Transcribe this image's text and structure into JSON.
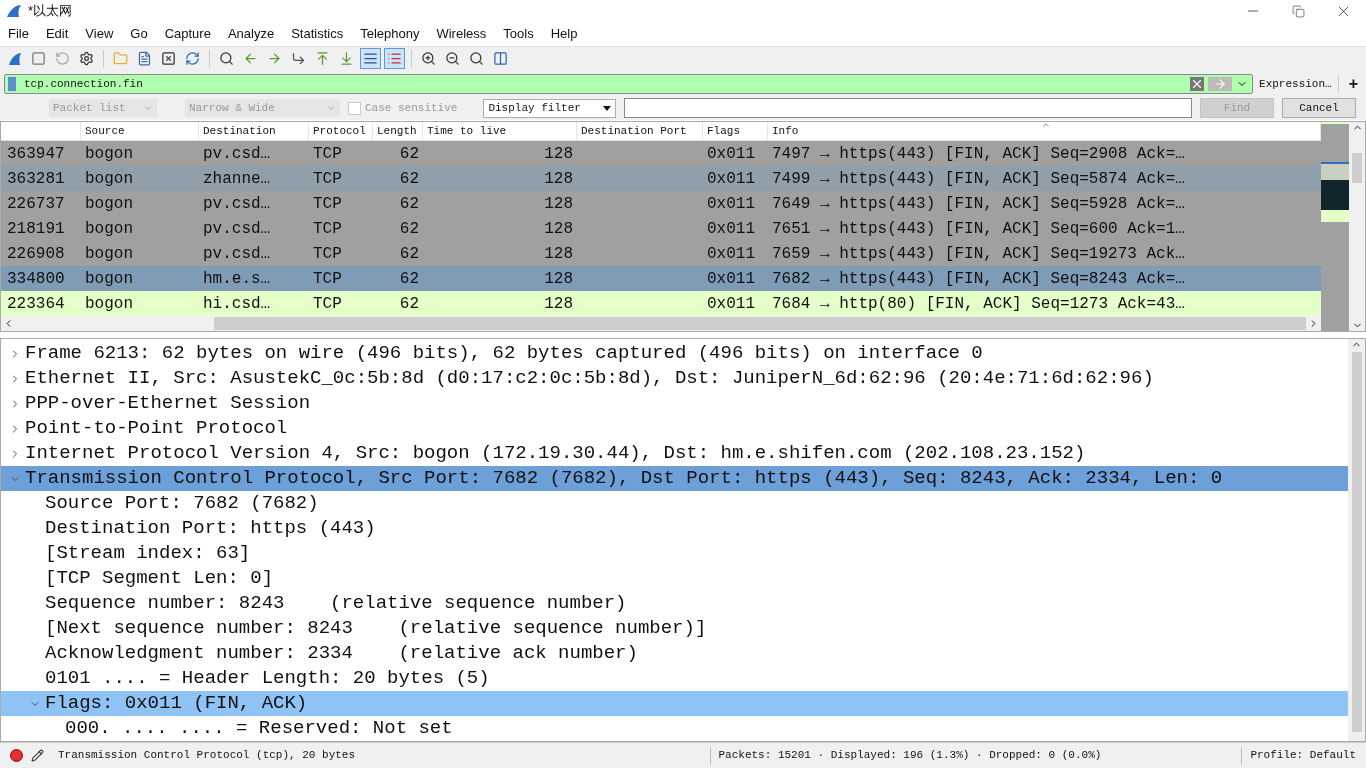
{
  "window": {
    "title": "*以太网"
  },
  "menu": [
    "File",
    "Edit",
    "View",
    "Go",
    "Capture",
    "Analyze",
    "Statistics",
    "Telephony",
    "Wireless",
    "Tools",
    "Help"
  ],
  "toolbar": [
    {
      "pressed": false
    },
    {
      "pressed": false
    },
    {
      "pressed": false
    },
    {
      "pressed": false
    },
    {
      "pressed": false
    },
    {
      "pressed": false
    },
    {
      "pressed": false
    },
    {
      "pressed": false
    },
    {
      "pressed": false
    },
    {
      "pressed": false
    },
    {
      "pressed": false
    },
    {
      "pressed": false
    },
    {
      "pressed": false
    },
    {
      "pressed": false
    },
    {
      "pressed": true
    },
    {
      "pressed": true
    },
    {
      "pressed": false
    },
    {
      "pressed": false
    },
    {
      "pressed": false
    },
    {
      "pressed": false
    }
  ],
  "filter": {
    "value": "tcp.connection.fin",
    "expression": "Expression…",
    "add": "+"
  },
  "find_bar": {
    "search_in": "Packet list",
    "char_width": "Narrow & Wide",
    "case_sensitive": {
      "label": "Case sensitive",
      "checked": false
    },
    "search_type": "Display filter",
    "find": "Find",
    "cancel": "Cancel"
  },
  "packet_list": {
    "columns": [
      "",
      "Source",
      "Destination",
      "Protocol",
      "Length",
      "Time to live",
      "Destination Port",
      "Flags",
      "Info"
    ],
    "rows": [
      {
        "cells": [
          "363947",
          "bogon",
          "pv.csd…",
          "TCP",
          "62",
          "128",
          "",
          "0x011",
          "7497 → https(443) [FIN, ACK] Seq=2908 Ack=…"
        ],
        "color": "#a0a0a0"
      },
      {
        "cells": [
          "363281",
          "bogon",
          "zhanne…",
          "TCP",
          "62",
          "128",
          "",
          "0x011",
          "7499 → https(443) [FIN, ACK] Seq=5874 Ack=…"
        ],
        "color": "#909fa9"
      },
      {
        "cells": [
          "226737",
          "bogon",
          "pv.csd…",
          "TCP",
          "62",
          "128",
          "",
          "0x011",
          "7649 → https(443) [FIN, ACK] Seq=5928 Ack=…"
        ],
        "color": "#a0a0a0"
      },
      {
        "cells": [
          "218191",
          "bogon",
          "pv.csd…",
          "TCP",
          "62",
          "128",
          "",
          "0x011",
          "7651 → https(443) [FIN, ACK] Seq=600 Ack=1…"
        ],
        "color": "#a0a0a0"
      },
      {
        "cells": [
          "226908",
          "bogon",
          "pv.csd…",
          "TCP",
          "62",
          "128",
          "",
          "0x011",
          "7659 → https(443) [FIN, ACK] Seq=19273 Ack…"
        ],
        "color": "#a0a0a0"
      },
      {
        "cells": [
          "334800",
          "bogon",
          "hm.e.s…",
          "TCP",
          "62",
          "128",
          "",
          "0x011",
          "7682 → https(443) [FIN, ACK] Seq=8243 Ack=…"
        ],
        "color": "#7f9bb6"
      },
      {
        "cells": [
          "223364",
          "bogon",
          "hi.csd…",
          "TCP",
          "62",
          "128",
          "",
          "0x011",
          "7684 → http(80) [FIN, ACK] Seq=1273 Ack=43…"
        ],
        "color": "#e4ffc7"
      }
    ]
  },
  "details": [
    {
      "text": "Frame 6213: 62 bytes on wire (496 bits), 62 bytes captured (496 bits) on interface 0",
      "expanded": false,
      "selected": false
    },
    {
      "text": "Ethernet II, Src: AsustekC_0c:5b:8d (d0:17:c2:0c:5b:8d), Dst: JuniperN_6d:62:96 (20:4e:71:6d:62:96)",
      "expanded": false,
      "selected": false
    },
    {
      "text": "PPP-over-Ethernet Session",
      "expanded": false,
      "selected": false
    },
    {
      "text": "Point-to-Point Protocol",
      "expanded": false,
      "selected": false
    },
    {
      "text": "Internet Protocol Version 4, Src: bogon (172.19.30.44), Dst: hm.e.shifen.com (202.108.23.152)",
      "expanded": false,
      "selected": false
    },
    {
      "text": "Transmission Control Protocol, Src Port: 7682 (7682), Dst Port: https (443), Seq: 8243, Ack: 2334, Len: 0",
      "expanded": true,
      "selected": true,
      "children": [
        {
          "text": "Source Port: 7682 (7682)"
        },
        {
          "text": "Destination Port: https (443)"
        },
        {
          "text": "[Stream index: 63]"
        },
        {
          "text": "[TCP Segment Len: 0]"
        },
        {
          "text": "Sequence number: 8243    (relative sequence number)"
        },
        {
          "text": "[Next sequence number: 8243    (relative sequence number)]"
        },
        {
          "text": "Acknowledgment number: 2334    (relative ack number)"
        },
        {
          "text": "0101 .... = Header Length: 20 bytes (5)"
        },
        {
          "text": "Flags: 0x011 (FIN, ACK)",
          "expanded": true,
          "selected": true,
          "children": [
            {
              "text": "000. .... .... = Reserved: Not set"
            }
          ]
        }
      ]
    }
  ],
  "status_bar": {
    "text": "Transmission Control Protocol (tcp), 20 bytes",
    "counts": "Packets: 15201 · Displayed: 196 (1.3%) · Dropped: 0 (0.0%)",
    "profile": "Profile: Default"
  }
}
